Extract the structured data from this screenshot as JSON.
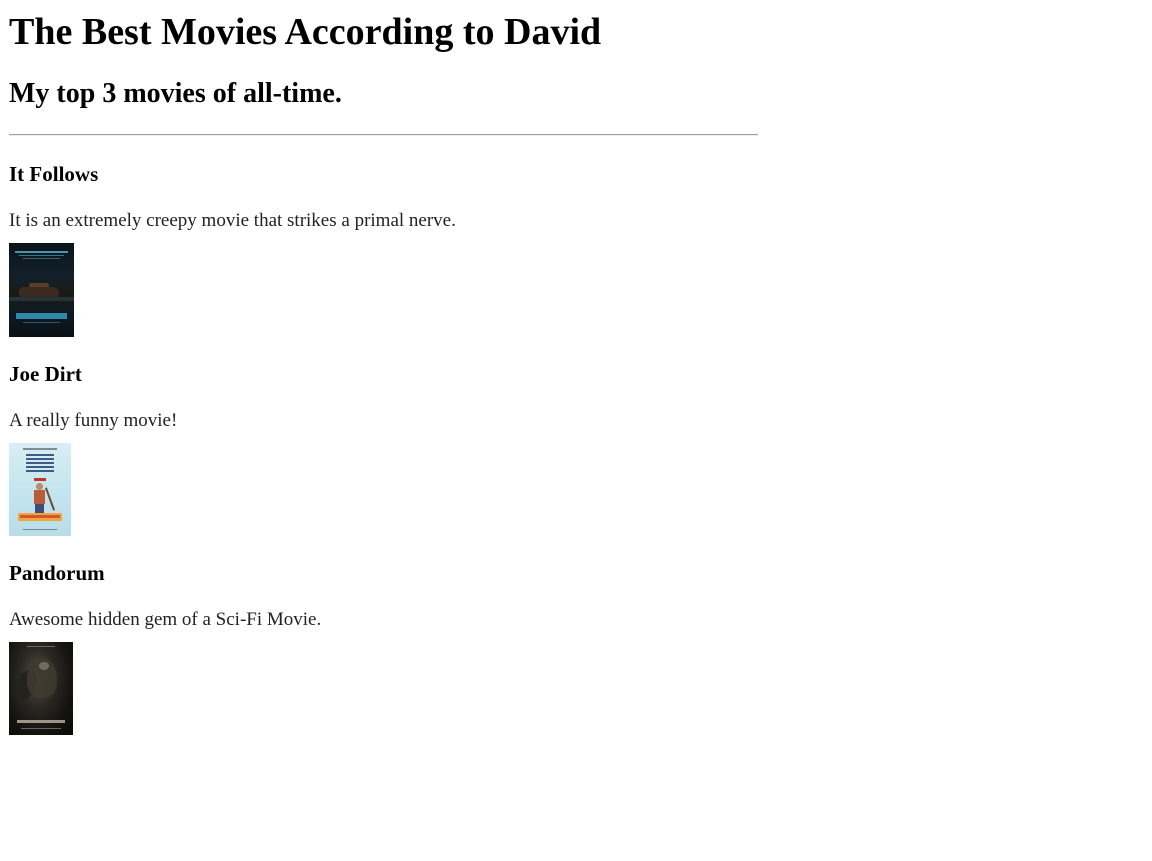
{
  "page": {
    "title": "The Best Movies According to David",
    "subtitle": "My top 3 movies of all-time."
  },
  "movies": [
    {
      "title": "It Follows",
      "description": "It is an extremely creepy movie that strikes a primal nerve.",
      "poster_icon": "it-follows-poster"
    },
    {
      "title": "Joe Dirt",
      "description": "A really funny movie!",
      "poster_icon": "joe-dirt-poster"
    },
    {
      "title": "Pandorum",
      "description": "Awesome hidden gem of a Sci-Fi Movie.",
      "poster_icon": "pandorum-poster"
    }
  ]
}
